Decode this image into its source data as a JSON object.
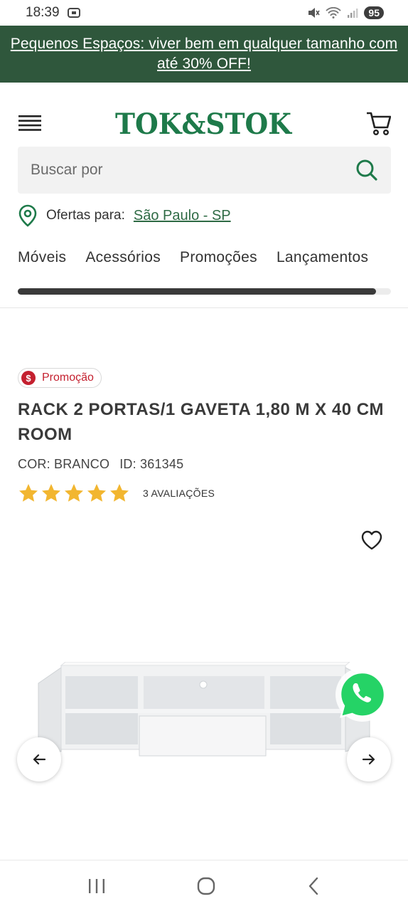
{
  "status_bar": {
    "time": "18:39",
    "battery": "95"
  },
  "promo_banner": {
    "text": "Pequenos Espaços: viver bem em qualquer tamanho com até 30% OFF!"
  },
  "header": {
    "logo_text": "TOK&STOK"
  },
  "search": {
    "placeholder": "Buscar por"
  },
  "location": {
    "label": "Ofertas para:",
    "city": "São Paulo - SP"
  },
  "categories": [
    "Móveis",
    "Acessórios",
    "Promoções",
    "Lançamentos"
  ],
  "category_scroll_progress": 0.96,
  "product": {
    "badge": "Promoção",
    "badge_symbol": "$",
    "title": "RACK 2 PORTAS/1 GAVETA 1,80 M X 40 CM ROOM",
    "color": "COR: BRANCO",
    "id": "ID: 361345",
    "rating": 5,
    "reviews": "3 AVALIAÇÕES"
  },
  "colors": {
    "brand_green": "#2f573c",
    "promo_red": "#c4202f",
    "star": "#f2b630",
    "whatsapp": "#25d366"
  },
  "icons": [
    "menu-icon",
    "cart-icon",
    "search-icon",
    "location-pin-icon",
    "heart-icon",
    "whatsapp-icon",
    "arrow-left-icon",
    "arrow-right-icon"
  ]
}
